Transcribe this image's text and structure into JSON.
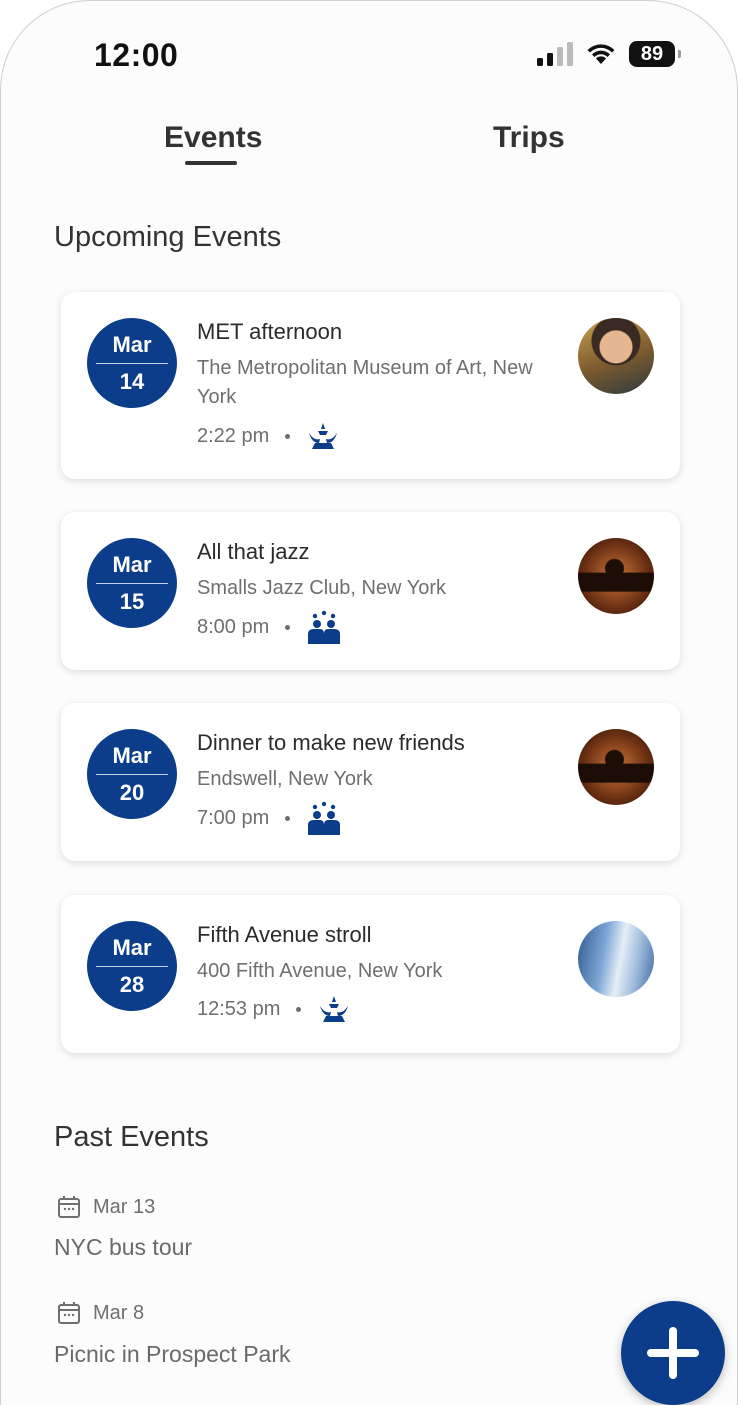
{
  "status_bar": {
    "time": "12:00",
    "battery": "89"
  },
  "tabs": [
    {
      "label": "Events",
      "active": true
    },
    {
      "label": "Trips",
      "active": false
    }
  ],
  "upcoming": {
    "title": "Upcoming Events",
    "events": [
      {
        "month": "Mar",
        "day": "14",
        "title": "MET afternoon",
        "location": "The Metropolitan Museum of Art, New York",
        "time": "2:22 pm",
        "category_icon": "fountain-icon",
        "avatar": "person-photo"
      },
      {
        "month": "Mar",
        "day": "15",
        "title": "All that jazz",
        "location": "Smalls Jazz Club, New York",
        "time": "8:00 pm",
        "category_icon": "group-icon",
        "avatar": "silhouette-photo"
      },
      {
        "month": "Mar",
        "day": "20",
        "title": "Dinner to make new friends",
        "location": "Endswell, New York",
        "time": "7:00 pm",
        "category_icon": "group-icon",
        "avatar": "silhouette-photo"
      },
      {
        "month": "Mar",
        "day": "28",
        "title": "Fifth Avenue stroll",
        "location": "400 Fifth Avenue, New York",
        "time": "12:53 pm",
        "category_icon": "fountain-icon",
        "avatar": "street-photo"
      }
    ]
  },
  "past": {
    "title": "Past Events",
    "events": [
      {
        "date": "Mar 13",
        "title": "NYC bus tour"
      },
      {
        "date": "Mar 8",
        "title": "Picnic in Prospect Park"
      }
    ]
  },
  "colors": {
    "brand": "#0b3d8a",
    "text": "#2b2b2b",
    "muted": "#6f6f6f"
  }
}
